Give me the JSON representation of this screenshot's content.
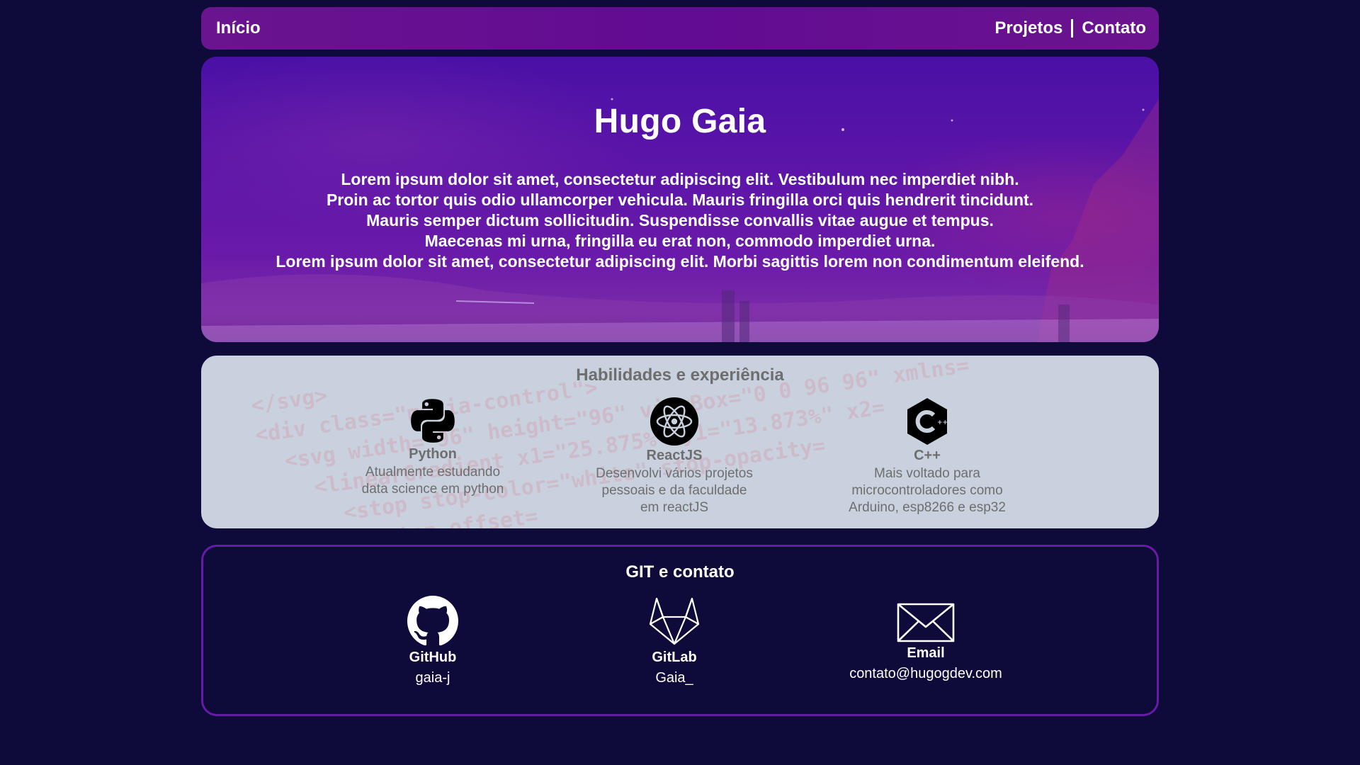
{
  "nav": {
    "home_label": "Início",
    "projects_label": "Projetos",
    "contact_label": "Contato"
  },
  "hero": {
    "name": "Hugo Gaia",
    "bio": "Lorem ipsum dolor sit amet, consectetur adipiscing elit. Vestibulum nec imperdiet nibh.\nProin ac tortor quis odio ullamcorper vehicula. Mauris fringilla orci quis hendrerit tincidunt.\nMauris semper dictum sollicitudin. Suspendisse convallis vitae augue et tempus.\nMaecenas mi urna, fringilla eu erat non, commodo imperdiet urna.\nLorem ipsum dolor sit amet, consectetur adipiscing elit. Morbi sagittis lorem non condimentum eleifend."
  },
  "skills": {
    "title": "Habilidades e experiência",
    "background_code": "</svg>\n<div class=\"media-control\">\n  <svg width=\"96\" height=\"96\" viewBox=\"0 0 96 96\" xmlns=\n    <linearGradient x1=\"25.875%\" y1=\"13.873%\" x2=\n      <stop stop-color=\"white\" stop-opacity=\n        <stop offset=\n          color=",
    "items": [
      {
        "icon": "python-icon",
        "name": "Python",
        "desc": "Atualmente estudando\ndata science em python"
      },
      {
        "icon": "react-icon",
        "name": "ReactJS",
        "desc": "Desenvolvi vários projetos\npessoais e da faculdade\nem reactJS"
      },
      {
        "icon": "cpp-icon",
        "name": "C++",
        "desc": "Mais voltado para\nmicrocontroladores como\nArduino, esp8266 e esp32"
      }
    ]
  },
  "contact": {
    "title": "GIT e contato",
    "items": [
      {
        "icon": "github-icon",
        "name": "GitHub",
        "value": "gaia-j"
      },
      {
        "icon": "gitlab-icon",
        "name": "GitLab",
        "value": "Gaia_"
      },
      {
        "icon": "mail-icon",
        "name": "Email",
        "value": "contato@hugogdev.com"
      }
    ]
  },
  "colors": {
    "page_bg": "#0e0b3a",
    "nav_bg": "#620b93",
    "hero_bg": "#5a14a8",
    "skills_bg": "#c9d1df",
    "contact_border": "#6a1aa8"
  }
}
